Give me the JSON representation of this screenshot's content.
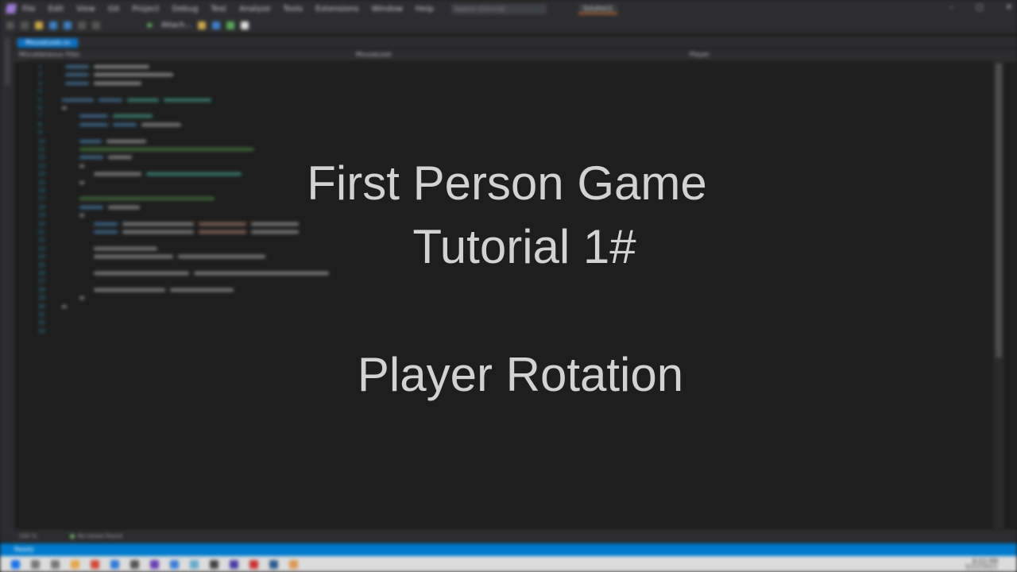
{
  "overlay": {
    "title_line1": "First Person Game",
    "title_line2": "Tutorial 1#",
    "subtitle": "Player Rotation"
  },
  "menu": {
    "items": [
      "File",
      "Edit",
      "View",
      "Git",
      "Project",
      "Debug",
      "Test",
      "Analyze",
      "Tools",
      "Extensions",
      "Window",
      "Help"
    ],
    "search_placeholder": "Search (Ctrl+Q)",
    "solution_name": "Solution1"
  },
  "toolbar": {
    "attach_label": "Attach..."
  },
  "editor": {
    "tab_label": "MouseLook.cs",
    "nav_left": "Miscellaneous Files",
    "nav_mid": "MouseLook",
    "nav_right": "Player",
    "line_numbers": [
      "1",
      "2",
      "3",
      "4",
      "5",
      "6",
      "7",
      "8",
      "9",
      "10",
      "11",
      "12",
      "13",
      "14",
      "15",
      "16",
      "17",
      "18",
      "19",
      "20",
      "21",
      "22",
      "23",
      "24",
      "25",
      "26",
      "27",
      "28",
      "29",
      "30",
      "31",
      "32",
      "33"
    ]
  },
  "status": {
    "zoom": "100 %",
    "issues": "No issues found",
    "ready": "Ready",
    "time": "8:03 PM",
    "date": "5/22/2021"
  },
  "colors": {
    "accent": "#007acc",
    "editor_bg": "#1e1e1e",
    "chrome_bg": "#2d2d30",
    "title_text": "#d2d2d2"
  }
}
